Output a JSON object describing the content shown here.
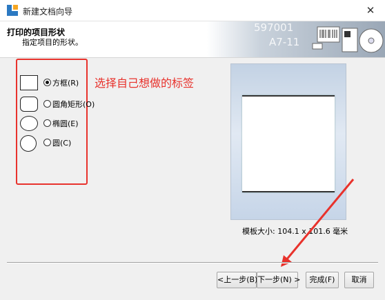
{
  "window": {
    "title": "新建文档向导",
    "close_glyph": "✕"
  },
  "banner": {
    "heading": "打印的项目形状",
    "subheading": "指定项目的形状。",
    "art_text_1": "597001",
    "art_text_2": "A7-11"
  },
  "shapes": [
    {
      "label": "方框(R)",
      "checked": true
    },
    {
      "label": "圆角矩形(O)",
      "checked": false
    },
    {
      "label": "椭圆(E)",
      "checked": false
    },
    {
      "label": "圆(C)",
      "checked": false
    }
  ],
  "annotation": {
    "text": "选择自己想做的标签",
    "color": "#e8322c"
  },
  "preview": {
    "size_text": "模板大小: 104.1 x 101.6 毫米"
  },
  "buttons": {
    "back": "<上一步(B)",
    "next": "下一步(N) >",
    "finish": "完成(F)",
    "cancel": "取消"
  }
}
